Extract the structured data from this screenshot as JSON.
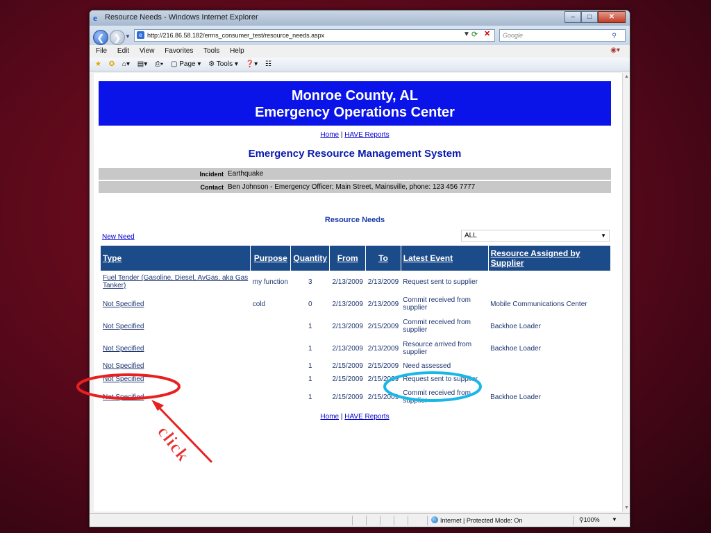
{
  "browser": {
    "window_title": "Resource Needs - Windows Internet Explorer",
    "url": "http://216.86.58.182/erms_consumer_test/resource_needs.aspx",
    "search_placeholder": "Google",
    "menu": [
      "File",
      "Edit",
      "View",
      "Favorites",
      "Tools",
      "Help"
    ],
    "toolbar": {
      "page_label": "Page",
      "tools_label": "Tools"
    },
    "status": {
      "zone": "Internet | Protected Mode: On",
      "zoom": "100%"
    }
  },
  "page": {
    "banner_line1": "Monroe County, AL",
    "banner_line2": "Emergency Operations Center",
    "links": {
      "home": "Home",
      "sep": "|",
      "reports": "HAVE Reports"
    },
    "system_title": "Emergency Resource Management System",
    "incident_label": "Incident",
    "incident_value": "Earthquake",
    "contact_label": "Contact",
    "contact_value": "Ben Johnson - Emergency Officer;  Main Street, Mainsville, phone: 123 456 7777",
    "section_title": "Resource Needs",
    "new_need": "New Need",
    "filter_value": "ALL",
    "table": {
      "headers": [
        "Type",
        "Purpose",
        "Quantity",
        "From",
        "To",
        "Latest Event",
        "Resource Assigned by Supplier"
      ],
      "rows": [
        {
          "type": "Fuel Tender (Gasoline, Diesel, AvGas, aka Gas Tanker)",
          "purpose": "my function",
          "quantity": "3",
          "from": "2/13/2009",
          "to": "2/13/2009",
          "event": "Request sent to supplier",
          "assigned": ""
        },
        {
          "type": "Not Specified",
          "purpose": "cold",
          "quantity": "0",
          "from": "2/13/2009",
          "to": "2/13/2009",
          "event": "Commit received from supplier",
          "assigned": "Mobile Communications Center"
        },
        {
          "type": "Not Specified",
          "purpose": "",
          "quantity": "1",
          "from": "2/13/2009",
          "to": "2/15/2009",
          "event": "Commit received from supplier",
          "assigned": "Backhoe Loader"
        },
        {
          "type": "Not Specified",
          "purpose": "",
          "quantity": "1",
          "from": "2/13/2009",
          "to": "2/13/2009",
          "event": "Resource arrived from supplier",
          "assigned": "Backhoe Loader"
        },
        {
          "type": "Not Specified",
          "purpose": "",
          "quantity": "1",
          "from": "2/15/2009",
          "to": "2/15/2009",
          "event": "Need assessed",
          "assigned": ""
        },
        {
          "type": "Not Specified",
          "purpose": "",
          "quantity": "1",
          "from": "2/15/2009",
          "to": "2/15/2009",
          "event": "Request sent to supplier",
          "assigned": ""
        },
        {
          "type": "Not Specified",
          "purpose": "",
          "quantity": "1",
          "from": "2/15/2009",
          "to": "2/15/2009",
          "event": "Commit received from supplier",
          "assigned": "Backhoe Loader"
        }
      ]
    }
  },
  "annotation": {
    "label": "click",
    "colors": {
      "red": "#e82020",
      "cyan": "#19b7e8"
    }
  }
}
